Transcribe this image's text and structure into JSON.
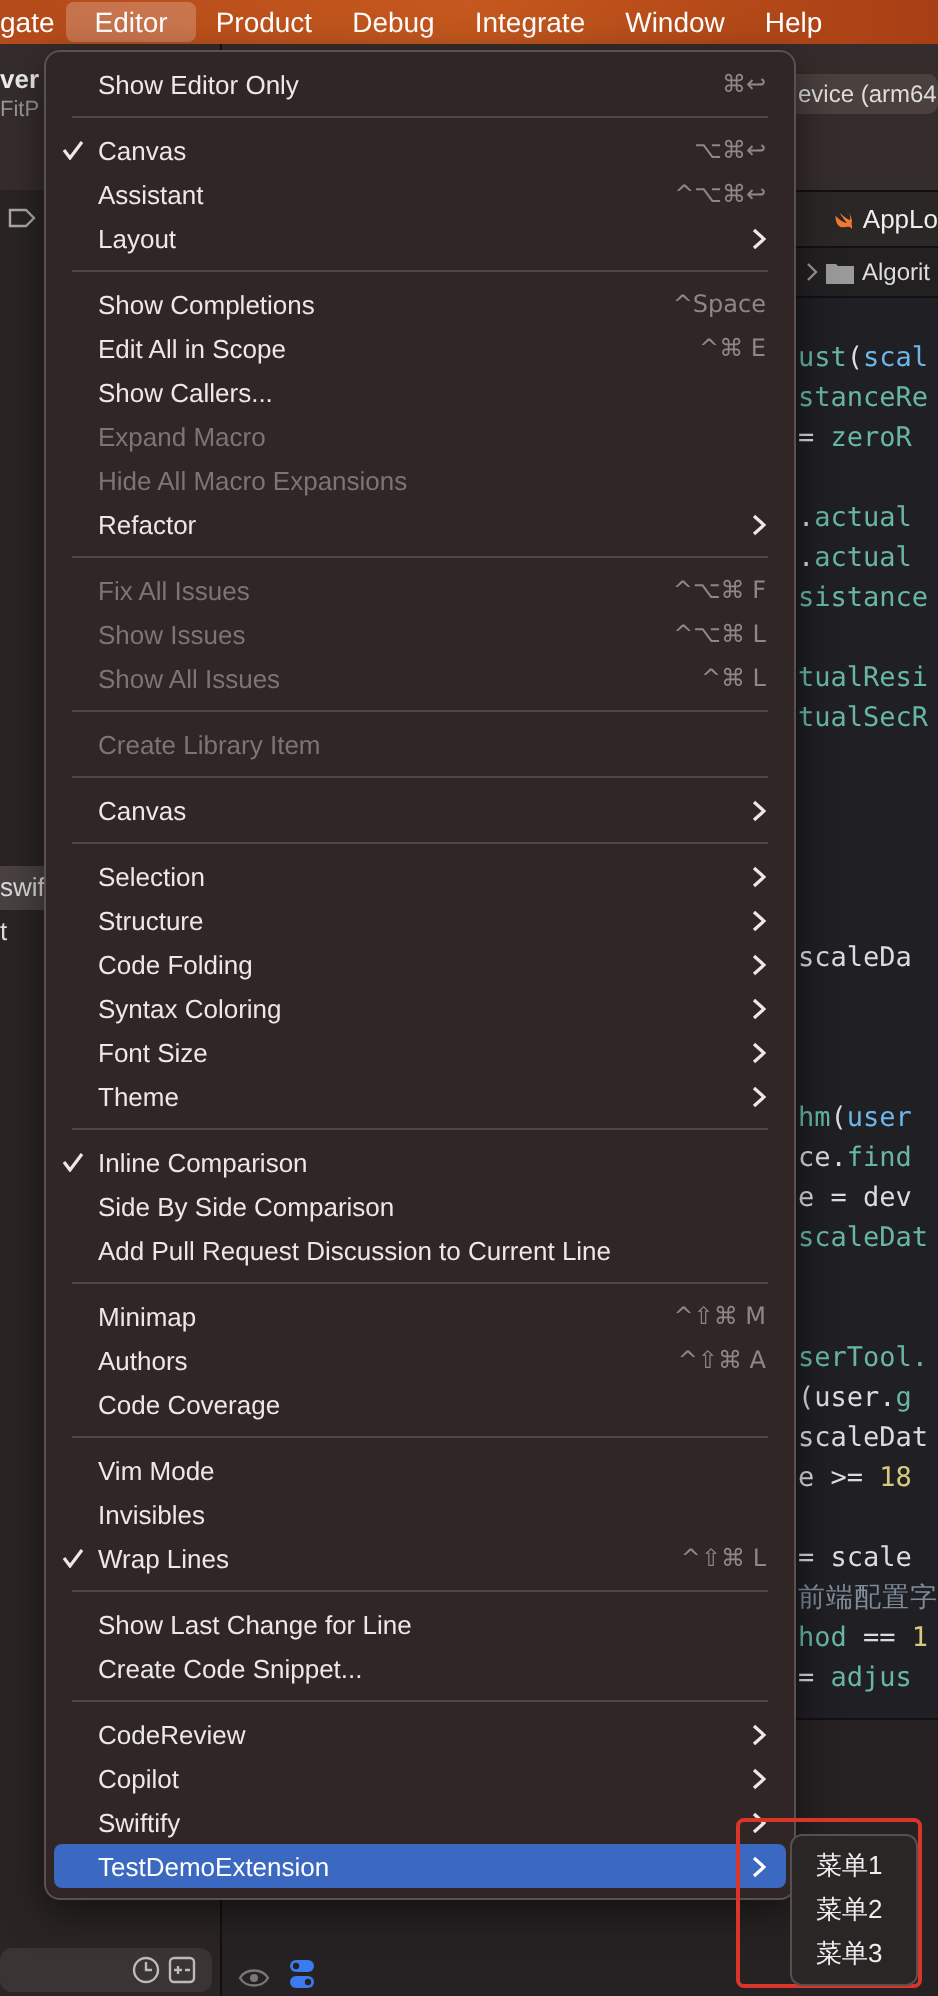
{
  "menu_bar": {
    "items": [
      {
        "label": "gate",
        "selected": false
      },
      {
        "label": "Editor",
        "selected": true
      },
      {
        "label": "Product",
        "selected": false
      },
      {
        "label": "Debug",
        "selected": false
      },
      {
        "label": "Integrate",
        "selected": false
      },
      {
        "label": "Window",
        "selected": false
      },
      {
        "label": "Help",
        "selected": false
      }
    ]
  },
  "sidebar": {
    "project_name": "ver",
    "project_subtitle": "FitP",
    "file_rows": [
      "swif",
      "t"
    ]
  },
  "editor": {
    "scheme_field": "evice (arm64",
    "tab": "AppLo",
    "jump_bar": "Algorit",
    "code_blocks": [
      {
        "kind": "short",
        "lines": [
          [
            {
              "text": "ust",
              "kind": "member"
            },
            {
              "text": "(",
              "kind": "plain"
            },
            {
              "text": "scal",
              "kind": "param"
            }
          ],
          [
            {
              "text": "stanceRe",
              "kind": "member"
            }
          ],
          [
            {
              "text": "= ",
              "kind": "plain"
            },
            {
              "text": "zeroR",
              "kind": "member"
            }
          ]
        ]
      },
      {
        "kind": "short",
        "lines": [
          [
            {
              "text": ".",
              "kind": "plain"
            },
            {
              "text": "actual",
              "kind": "member"
            }
          ],
          [
            {
              "text": ".",
              "kind": "plain"
            },
            {
              "text": "actual",
              "kind": "member"
            }
          ],
          [
            {
              "text": "sistance",
              "kind": "member"
            }
          ]
        ]
      },
      {
        "kind": "short",
        "lines": [
          [
            {
              "text": "tualResi",
              "kind": "member"
            }
          ],
          [
            {
              "text": "tualSecR",
              "kind": "member"
            }
          ]
        ]
      },
      {
        "kind": "longest",
        "lines": [
          [
            {
              "text": "scaleDa",
              "kind": "plain"
            }
          ]
        ]
      },
      {
        "kind": "long",
        "lines": [
          [
            {
              "text": "hm",
              "kind": "member"
            },
            {
              "text": "(",
              "kind": "plain"
            },
            {
              "text": "user",
              "kind": "param"
            }
          ],
          [
            {
              "text": "ce.",
              "kind": "plain"
            },
            {
              "text": "find",
              "kind": "member"
            }
          ],
          [
            {
              "text": "e = dev",
              "kind": "plain"
            }
          ],
          [
            {
              "text": "scaleDat",
              "kind": "member"
            }
          ]
        ]
      },
      {
        "kind": "medium",
        "lines": [
          [
            {
              "text": "serTool.",
              "kind": "member"
            }
          ],
          [
            {
              "text": "(user.",
              "kind": "plain"
            },
            {
              "text": "g",
              "kind": "member"
            }
          ],
          [
            {
              "text": "scaleDat",
              "kind": "plain"
            }
          ],
          [
            {
              "text": "e >= ",
              "kind": "plain"
            },
            {
              "text": "18",
              "kind": "number"
            }
          ]
        ]
      },
      {
        "kind": "short",
        "lines": [
          [
            {
              "text": "= scale",
              "kind": "plain"
            }
          ],
          [
            {
              "text": "前端配置字",
              "kind": "comment"
            }
          ],
          [
            {
              "text": "hod",
              "kind": "member"
            },
            {
              "text": " == ",
              "kind": "plain"
            },
            {
              "text": "1",
              "kind": "number"
            }
          ],
          [
            {
              "text": "= ",
              "kind": "plain"
            },
            {
              "text": "adjus",
              "kind": "member"
            }
          ]
        ]
      }
    ]
  },
  "menu": {
    "items": [
      {
        "kind": "item",
        "label": "Show Editor Only",
        "shortcut": "⌘↩",
        "checked": false,
        "disabled": false,
        "submenu": false,
        "selected": false
      },
      {
        "kind": "separator"
      },
      {
        "kind": "item",
        "label": "Canvas",
        "shortcut": "⌥⌘↩",
        "checked": true,
        "disabled": false,
        "submenu": false,
        "selected": false
      },
      {
        "kind": "item",
        "label": "Assistant",
        "shortcut": "^⌥⌘↩",
        "checked": false,
        "disabled": false,
        "submenu": false,
        "selected": false
      },
      {
        "kind": "item",
        "label": "Layout",
        "checked": false,
        "disabled": false,
        "submenu": true,
        "selected": false
      },
      {
        "kind": "separator"
      },
      {
        "kind": "item",
        "label": "Show Completions",
        "shortcut": "^Space",
        "checked": false,
        "disabled": false,
        "submenu": false,
        "selected": false
      },
      {
        "kind": "item",
        "label": "Edit All in Scope",
        "shortcut": "^⌘ E",
        "checked": false,
        "disabled": false,
        "submenu": false,
        "selected": false
      },
      {
        "kind": "item",
        "label": "Show Callers...",
        "checked": false,
        "disabled": false,
        "submenu": false,
        "selected": false
      },
      {
        "kind": "item",
        "label": "Expand Macro",
        "checked": false,
        "disabled": true,
        "submenu": false,
        "selected": false
      },
      {
        "kind": "item",
        "label": "Hide All Macro Expansions",
        "checked": false,
        "disabled": true,
        "submenu": false,
        "selected": false
      },
      {
        "kind": "item",
        "label": "Refactor",
        "checked": false,
        "disabled": false,
        "submenu": true,
        "selected": false
      },
      {
        "kind": "separator"
      },
      {
        "kind": "item",
        "label": "Fix All Issues",
        "shortcut": "^⌥⌘ F",
        "checked": false,
        "disabled": true,
        "submenu": false,
        "selected": false
      },
      {
        "kind": "item",
        "label": "Show Issues",
        "shortcut": "^⌥⌘ L",
        "checked": false,
        "disabled": true,
        "submenu": false,
        "selected": false
      },
      {
        "kind": "item",
        "label": "Show All Issues",
        "shortcut": "^⌘ L",
        "checked": false,
        "disabled": true,
        "submenu": false,
        "selected": false
      },
      {
        "kind": "separator"
      },
      {
        "kind": "item",
        "label": "Create Library Item",
        "checked": false,
        "disabled": true,
        "submenu": false,
        "selected": false
      },
      {
        "kind": "separator"
      },
      {
        "kind": "item",
        "label": "Canvas",
        "checked": false,
        "disabled": false,
        "submenu": true,
        "selected": false
      },
      {
        "kind": "separator"
      },
      {
        "kind": "item",
        "label": "Selection",
        "checked": false,
        "disabled": false,
        "submenu": true,
        "selected": false
      },
      {
        "kind": "item",
        "label": "Structure",
        "checked": false,
        "disabled": false,
        "submenu": true,
        "selected": false
      },
      {
        "kind": "item",
        "label": "Code Folding",
        "checked": false,
        "disabled": false,
        "submenu": true,
        "selected": false
      },
      {
        "kind": "item",
        "label": "Syntax Coloring",
        "checked": false,
        "disabled": false,
        "submenu": true,
        "selected": false
      },
      {
        "kind": "item",
        "label": "Font Size",
        "checked": false,
        "disabled": false,
        "submenu": true,
        "selected": false
      },
      {
        "kind": "item",
        "label": "Theme",
        "checked": false,
        "disabled": false,
        "submenu": true,
        "selected": false
      },
      {
        "kind": "separator"
      },
      {
        "kind": "item",
        "label": "Inline Comparison",
        "checked": true,
        "disabled": false,
        "submenu": false,
        "selected": false
      },
      {
        "kind": "item",
        "label": "Side By Side Comparison",
        "checked": false,
        "disabled": false,
        "submenu": false,
        "selected": false
      },
      {
        "kind": "item",
        "label": "Add Pull Request Discussion to Current Line",
        "checked": false,
        "disabled": false,
        "submenu": false,
        "selected": false
      },
      {
        "kind": "separator"
      },
      {
        "kind": "item",
        "label": "Minimap",
        "shortcut": "^⇧⌘ M",
        "checked": false,
        "disabled": false,
        "submenu": false,
        "selected": false
      },
      {
        "kind": "item",
        "label": "Authors",
        "shortcut": "^⇧⌘ A",
        "checked": false,
        "disabled": false,
        "submenu": false,
        "selected": false
      },
      {
        "kind": "item",
        "label": "Code Coverage",
        "checked": false,
        "disabled": false,
        "submenu": false,
        "selected": false
      },
      {
        "kind": "separator"
      },
      {
        "kind": "item",
        "label": "Vim Mode",
        "checked": false,
        "disabled": false,
        "submenu": false,
        "selected": false
      },
      {
        "kind": "item",
        "label": "Invisibles",
        "checked": false,
        "disabled": false,
        "submenu": false,
        "selected": false
      },
      {
        "kind": "item",
        "label": "Wrap Lines",
        "shortcut": "^⇧⌘ L",
        "checked": true,
        "disabled": false,
        "submenu": false,
        "selected": false
      },
      {
        "kind": "separator"
      },
      {
        "kind": "item",
        "label": "Show Last Change for Line",
        "checked": false,
        "disabled": false,
        "submenu": false,
        "selected": false
      },
      {
        "kind": "item",
        "label": "Create Code Snippet...",
        "checked": false,
        "disabled": false,
        "submenu": false,
        "selected": false
      },
      {
        "kind": "separator"
      },
      {
        "kind": "item",
        "label": "CodeReview",
        "checked": false,
        "disabled": false,
        "submenu": true,
        "selected": false
      },
      {
        "kind": "item",
        "label": "Copilot",
        "checked": false,
        "disabled": false,
        "submenu": true,
        "selected": false
      },
      {
        "kind": "item",
        "label": "Swiftify",
        "checked": false,
        "disabled": false,
        "submenu": true,
        "selected": false
      },
      {
        "kind": "item",
        "label": "TestDemoExtension",
        "checked": false,
        "disabled": false,
        "submenu": true,
        "selected": true
      }
    ]
  },
  "submenu": {
    "items": [
      "菜单1",
      "菜单2",
      "菜单3"
    ]
  }
}
